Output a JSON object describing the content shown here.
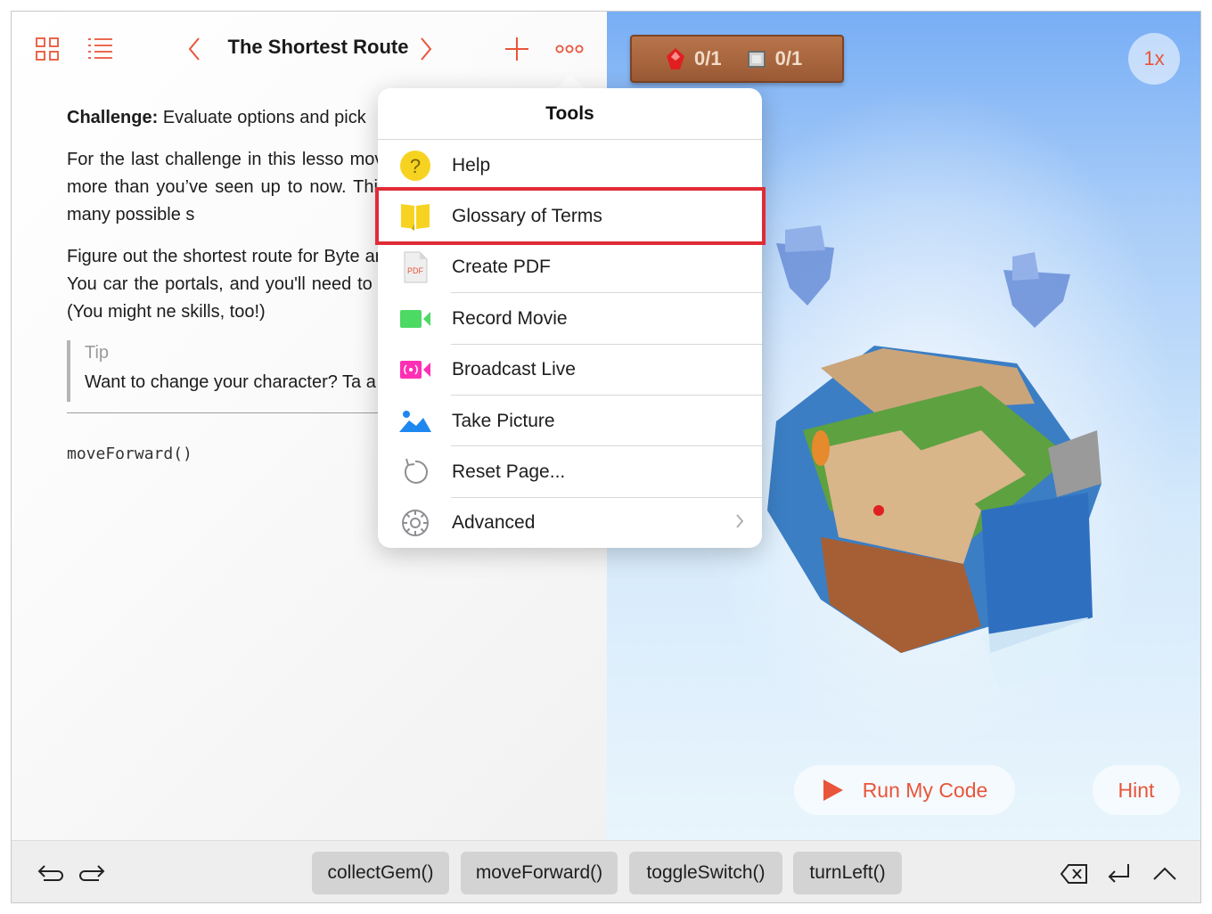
{
  "nav": {
    "title": "The Shortest Route"
  },
  "content": {
    "challenge_label": "Challenge:",
    "challenge_text": "Evaluate options and pick",
    "para1": "For the last challenge in this lesso move around in a bigger and more than you’ve seen up to now. This w jumps, and there are many possible s",
    "para2": "Figure out the shortest route for Byte and toggle open the switch. You car the portals, and you'll need to use th learned up to now. (You might ne skills, too!)",
    "tip_label": "Tip",
    "tip_text": "Want to change your character? Ta a new look.",
    "code": "moveForward()"
  },
  "scoreboard": {
    "gems": "0/1",
    "switches": "0/1"
  },
  "speed_label": "1x",
  "run_label": "Run My Code",
  "hint_label": "Hint",
  "snippets": [
    "collectGem()",
    "moveForward()",
    "toggleSwitch()",
    "turnLeft()"
  ],
  "tools": {
    "title": "Tools",
    "items": [
      {
        "label": "Help",
        "icon": "help-icon"
      },
      {
        "label": "Glossary of Terms",
        "icon": "book-icon"
      },
      {
        "label": "Create PDF",
        "icon": "pdf-icon"
      },
      {
        "label": "Record Movie",
        "icon": "video-camera-icon"
      },
      {
        "label": "Broadcast Live",
        "icon": "broadcast-icon"
      },
      {
        "label": "Take Picture",
        "icon": "picture-icon"
      },
      {
        "label": "Reset Page...",
        "icon": "reset-icon"
      },
      {
        "label": "Advanced",
        "icon": "gear-icon"
      }
    ]
  },
  "colors": {
    "accent": "#e8553a",
    "highlight": "#e02b36"
  }
}
